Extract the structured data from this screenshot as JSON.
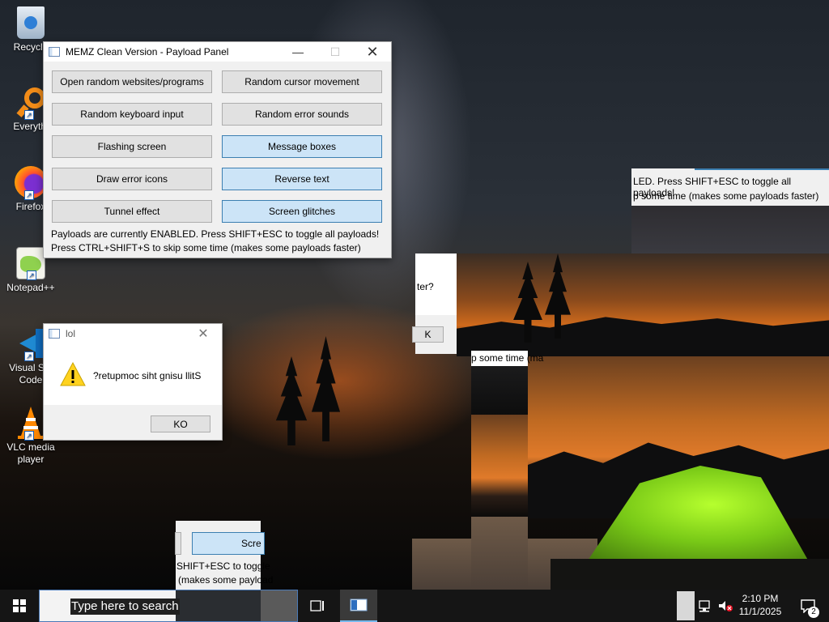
{
  "desktop_icons": [
    {
      "label": "Recycle",
      "icon": "recycle-bin-icon"
    },
    {
      "label": "Everythi",
      "icon": "everything-search-icon"
    },
    {
      "label": "Firefox",
      "icon": "firefox-icon"
    },
    {
      "label": "Notepad++",
      "icon": "notepad-plus-plus-icon"
    },
    {
      "label": "Visual Stu Code",
      "icon": "vscode-icon"
    },
    {
      "label": "VLC media player",
      "icon": "vlc-icon"
    }
  ],
  "payload_panel": {
    "title": "MEMZ Clean Version - Payload Panel",
    "buttons": [
      {
        "label": "Open random websites/programs",
        "active": false
      },
      {
        "label": "Random cursor movement",
        "active": false
      },
      {
        "label": "Random keyboard input",
        "active": false
      },
      {
        "label": "Random error sounds",
        "active": false
      },
      {
        "label": "Flashing screen",
        "active": false
      },
      {
        "label": "Message boxes",
        "active": true
      },
      {
        "label": "Draw error icons",
        "active": false
      },
      {
        "label": "Reverse text",
        "active": true
      },
      {
        "label": "Tunnel effect",
        "active": false
      },
      {
        "label": "Screen glitches",
        "active": true
      }
    ],
    "status_line1": "Payloads are currently ENABLED. Press SHIFT+ESC to toggle all payloads!",
    "status_line2": "Press CTRL+SHIFT+S to skip some time (makes some payloads faster)"
  },
  "message_box": {
    "title": "lol",
    "message": "?retupmoc siht gnisu llitS",
    "ok_label": "KO",
    "icon": "warning-icon"
  },
  "glitch_fragments": {
    "panel_right_line1": "LED. Press SHIFT+ESC to toggle all payloads!",
    "panel_right_line2": "p some time (makes some payloads faster)",
    "dialog_fragment_text": "ter?",
    "dialog_fragment_btn": "K",
    "skip_fragment": "p some time (ma",
    "bottom_btn": "Scre",
    "bottom_line1": "SHIFT+ESC to toggle",
    "bottom_line2": "(makes some payload"
  },
  "taskbar": {
    "search_placeholder": "Type here to search",
    "time": "2:10 PM",
    "date": "11/1/2025",
    "notification_count": "2"
  },
  "colors": {
    "active_button": "#cce4f7",
    "taskbar": "#151515",
    "accent": "#3c7fb1"
  }
}
